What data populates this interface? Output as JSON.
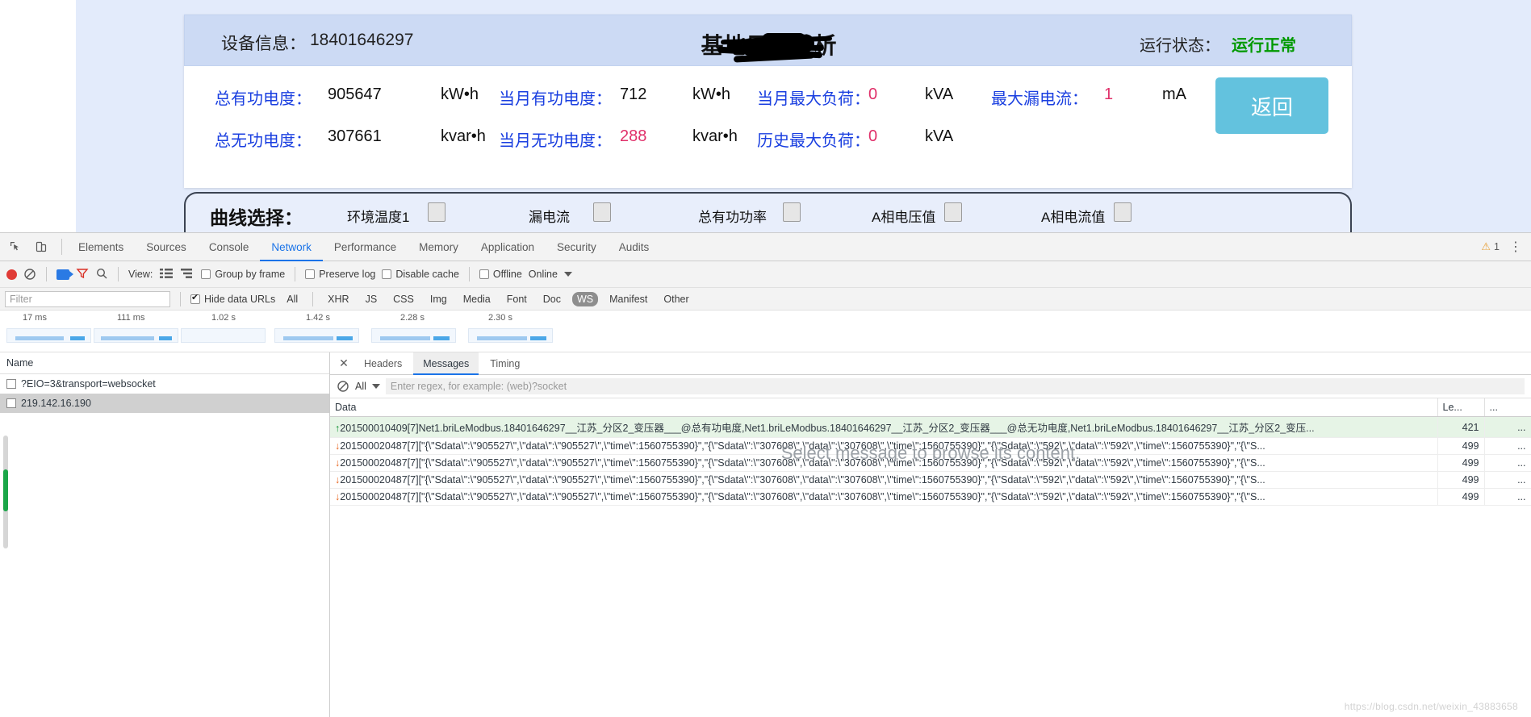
{
  "webapp": {
    "device_label": "设备信息：",
    "device_value": "18401646297",
    "title": "基地用能分析",
    "status_label": "运行状态：",
    "status_value": "运行正常",
    "status_color": "#009900",
    "back_button": "返回",
    "metrics": [
      {
        "label": "总有功电度：",
        "value": "905647",
        "unit": "kW•h",
        "red": false
      },
      {
        "label": "当月有功电度：",
        "value": "712",
        "unit": "kW•h",
        "red": false
      },
      {
        "label": "当月最大负荷：",
        "value": "0",
        "unit": "kVA",
        "red": true
      },
      {
        "label": "最大漏电流：",
        "value": "1",
        "unit": "mA",
        "red": true
      },
      {
        "label": "总无功电度：",
        "value": "307661",
        "unit": "kvar•h",
        "red": false
      },
      {
        "label": "当月无功电度：",
        "value": "288",
        "unit": "kvar•h",
        "red": true
      },
      {
        "label": "历史最大负荷：",
        "value": "0",
        "unit": "kVA",
        "red": true
      }
    ],
    "curve": {
      "title": "曲线选择：",
      "items": [
        {
          "label": "环境温度1",
          "checked": false
        },
        {
          "label": "漏电流",
          "checked": false
        },
        {
          "label": "总有功功率",
          "checked": false
        },
        {
          "label": "A相电压值",
          "checked": false
        },
        {
          "label": "A相电流值",
          "checked": false
        }
      ]
    }
  },
  "devtools": {
    "tabs": [
      {
        "label": "Elements",
        "active": false
      },
      {
        "label": "Sources",
        "active": false
      },
      {
        "label": "Console",
        "active": false
      },
      {
        "label": "Network",
        "active": true
      },
      {
        "label": "Performance",
        "active": false
      },
      {
        "label": "Memory",
        "active": false
      },
      {
        "label": "Application",
        "active": false
      },
      {
        "label": "Security",
        "active": false
      },
      {
        "label": "Audits",
        "active": false
      }
    ],
    "warning_count": "1",
    "toolbar": {
      "view_label": "View:",
      "group_by_frame": "Group by frame",
      "preserve_log": "Preserve log",
      "disable_cache": "Disable cache",
      "offline": "Offline",
      "online": "Online"
    },
    "filterbar": {
      "filter_placeholder": "Filter",
      "filter_value": "",
      "hide_data_urls": "Hide data URLs",
      "hide_data_urls_checked": true,
      "types": [
        {
          "label": "All",
          "selected": false
        },
        {
          "label": "XHR",
          "selected": false
        },
        {
          "label": "JS",
          "selected": false
        },
        {
          "label": "CSS",
          "selected": false
        },
        {
          "label": "Img",
          "selected": false
        },
        {
          "label": "Media",
          "selected": false
        },
        {
          "label": "Font",
          "selected": false
        },
        {
          "label": "Doc",
          "selected": false
        },
        {
          "label": "WS",
          "selected": true
        },
        {
          "label": "Manifest",
          "selected": false
        },
        {
          "label": "Other",
          "selected": false
        }
      ]
    },
    "overview_ticks": [
      "17 ms",
      "111 ms",
      "1.02 s",
      "1.42 s",
      "2.28 s",
      "2.30 s"
    ],
    "names": {
      "header": "Name",
      "rows": [
        {
          "label": "?EIO=3&transport=websocket",
          "selected": false
        },
        {
          "label": "219.142.16.190",
          "selected": true
        }
      ]
    },
    "detail": {
      "tabs": [
        {
          "label": "Headers",
          "active": false
        },
        {
          "label": "Messages",
          "active": true
        },
        {
          "label": "Timing",
          "active": false
        }
      ],
      "msg_filter_label": "All",
      "msg_filter_placeholder": "Enter regex, for example: (web)?socket",
      "msg_filter_value": "",
      "columns": [
        "Data",
        "Le...",
        "..."
      ],
      "rows": [
        {
          "dir": "sent",
          "data": "201500010409[7]Net1.briLeModbus.18401646297__江苏_分区2_变压器___@总有功电度,Net1.briLeModbus.18401646297__江苏_分区2_变压器___@总无功电度,Net1.briLeModbus.18401646297__江苏_分区2_变压...",
          "length": "421",
          "time": "..."
        },
        {
          "dir": "received",
          "data": "201500020487[7][\"{\\\"Sdata\\\":\\\"905527\\\",\\\"data\\\":\\\"905527\\\",\\\"time\\\":1560755390}\",\"{\\\"Sdata\\\":\\\"307608\\\",\\\"data\\\":\\\"307608\\\",\\\"time\\\":1560755390}\",\"{\\\"Sdata\\\":\\\"592\\\",\\\"data\\\":\\\"592\\\",\\\"time\\\":1560755390}\",\"{\\\"S...",
          "length": "499",
          "time": "..."
        },
        {
          "dir": "received",
          "data": "201500020487[7][\"{\\\"Sdata\\\":\\\"905527\\\",\\\"data\\\":\\\"905527\\\",\\\"time\\\":1560755390}\",\"{\\\"Sdata\\\":\\\"307608\\\",\\\"data\\\":\\\"307608\\\",\\\"time\\\":1560755390}\",\"{\\\"Sdata\\\":\\\"592\\\",\\\"data\\\":\\\"592\\\",\\\"time\\\":1560755390}\",\"{\\\"S...",
          "length": "499",
          "time": "..."
        },
        {
          "dir": "received",
          "data": "201500020487[7][\"{\\\"Sdata\\\":\\\"905527\\\",\\\"data\\\":\\\"905527\\\",\\\"time\\\":1560755390}\",\"{\\\"Sdata\\\":\\\"307608\\\",\\\"data\\\":\\\"307608\\\",\\\"time\\\":1560755390}\",\"{\\\"Sdata\\\":\\\"592\\\",\\\"data\\\":\\\"592\\\",\\\"time\\\":1560755390}\",\"{\\\"S...",
          "length": "499",
          "time": "..."
        },
        {
          "dir": "received",
          "data": "201500020487[7][\"{\\\"Sdata\\\":\\\"905527\\\",\\\"data\\\":\\\"905527\\\",\\\"time\\\":1560755390}\",\"{\\\"Sdata\\\":\\\"307608\\\",\\\"data\\\":\\\"307608\\\",\\\"time\\\":1560755390}\",\"{\\\"Sdata\\\":\\\"592\\\",\\\"data\\\":\\\"592\\\",\\\"time\\\":1560755390}\",\"{\\\"S...",
          "length": "499",
          "time": "..."
        }
      ],
      "empty_hint": "Select message to browse its content."
    }
  },
  "watermark": "https://blog.csdn.net/weixin_43883658"
}
